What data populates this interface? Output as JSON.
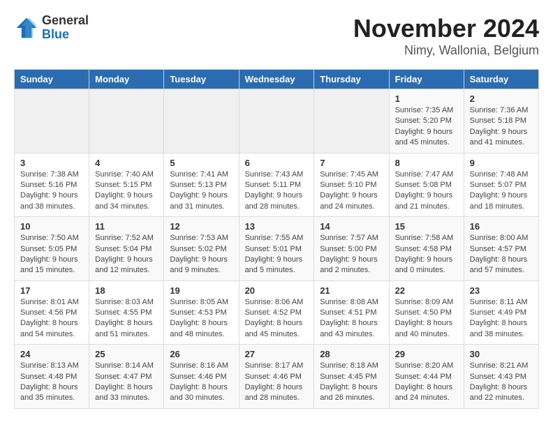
{
  "header": {
    "logo": {
      "general": "General",
      "blue": "Blue"
    },
    "title": "November 2024",
    "subtitle": "Nimy, Wallonia, Belgium"
  },
  "calendar": {
    "days_of_week": [
      "Sunday",
      "Monday",
      "Tuesday",
      "Wednesday",
      "Thursday",
      "Friday",
      "Saturday"
    ],
    "weeks": [
      [
        {
          "day": "",
          "info": ""
        },
        {
          "day": "",
          "info": ""
        },
        {
          "day": "",
          "info": ""
        },
        {
          "day": "",
          "info": ""
        },
        {
          "day": "",
          "info": ""
        },
        {
          "day": "1",
          "info": "Sunrise: 7:35 AM\nSunset: 5:20 PM\nDaylight: 9 hours and 45 minutes."
        },
        {
          "day": "2",
          "info": "Sunrise: 7:36 AM\nSunset: 5:18 PM\nDaylight: 9 hours and 41 minutes."
        }
      ],
      [
        {
          "day": "3",
          "info": "Sunrise: 7:38 AM\nSunset: 5:16 PM\nDaylight: 9 hours and 38 minutes."
        },
        {
          "day": "4",
          "info": "Sunrise: 7:40 AM\nSunset: 5:15 PM\nDaylight: 9 hours and 34 minutes."
        },
        {
          "day": "5",
          "info": "Sunrise: 7:41 AM\nSunset: 5:13 PM\nDaylight: 9 hours and 31 minutes."
        },
        {
          "day": "6",
          "info": "Sunrise: 7:43 AM\nSunset: 5:11 PM\nDaylight: 9 hours and 28 minutes."
        },
        {
          "day": "7",
          "info": "Sunrise: 7:45 AM\nSunset: 5:10 PM\nDaylight: 9 hours and 24 minutes."
        },
        {
          "day": "8",
          "info": "Sunrise: 7:47 AM\nSunset: 5:08 PM\nDaylight: 9 hours and 21 minutes."
        },
        {
          "day": "9",
          "info": "Sunrise: 7:48 AM\nSunset: 5:07 PM\nDaylight: 9 hours and 18 minutes."
        }
      ],
      [
        {
          "day": "10",
          "info": "Sunrise: 7:50 AM\nSunset: 5:05 PM\nDaylight: 9 hours and 15 minutes."
        },
        {
          "day": "11",
          "info": "Sunrise: 7:52 AM\nSunset: 5:04 PM\nDaylight: 9 hours and 12 minutes."
        },
        {
          "day": "12",
          "info": "Sunrise: 7:53 AM\nSunset: 5:02 PM\nDaylight: 9 hours and 9 minutes."
        },
        {
          "day": "13",
          "info": "Sunrise: 7:55 AM\nSunset: 5:01 PM\nDaylight: 9 hours and 5 minutes."
        },
        {
          "day": "14",
          "info": "Sunrise: 7:57 AM\nSunset: 5:00 PM\nDaylight: 9 hours and 2 minutes."
        },
        {
          "day": "15",
          "info": "Sunrise: 7:58 AM\nSunset: 4:58 PM\nDaylight: 9 hours and 0 minutes."
        },
        {
          "day": "16",
          "info": "Sunrise: 8:00 AM\nSunset: 4:57 PM\nDaylight: 8 hours and 57 minutes."
        }
      ],
      [
        {
          "day": "17",
          "info": "Sunrise: 8:01 AM\nSunset: 4:56 PM\nDaylight: 8 hours and 54 minutes."
        },
        {
          "day": "18",
          "info": "Sunrise: 8:03 AM\nSunset: 4:55 PM\nDaylight: 8 hours and 51 minutes."
        },
        {
          "day": "19",
          "info": "Sunrise: 8:05 AM\nSunset: 4:53 PM\nDaylight: 8 hours and 48 minutes."
        },
        {
          "day": "20",
          "info": "Sunrise: 8:06 AM\nSunset: 4:52 PM\nDaylight: 8 hours and 45 minutes."
        },
        {
          "day": "21",
          "info": "Sunrise: 8:08 AM\nSunset: 4:51 PM\nDaylight: 8 hours and 43 minutes."
        },
        {
          "day": "22",
          "info": "Sunrise: 8:09 AM\nSunset: 4:50 PM\nDaylight: 8 hours and 40 minutes."
        },
        {
          "day": "23",
          "info": "Sunrise: 8:11 AM\nSunset: 4:49 PM\nDaylight: 8 hours and 38 minutes."
        }
      ],
      [
        {
          "day": "24",
          "info": "Sunrise: 8:13 AM\nSunset: 4:48 PM\nDaylight: 8 hours and 35 minutes."
        },
        {
          "day": "25",
          "info": "Sunrise: 8:14 AM\nSunset: 4:47 PM\nDaylight: 8 hours and 33 minutes."
        },
        {
          "day": "26",
          "info": "Sunrise: 8:16 AM\nSunset: 4:46 PM\nDaylight: 8 hours and 30 minutes."
        },
        {
          "day": "27",
          "info": "Sunrise: 8:17 AM\nSunset: 4:46 PM\nDaylight: 8 hours and 28 minutes."
        },
        {
          "day": "28",
          "info": "Sunrise: 8:18 AM\nSunset: 4:45 PM\nDaylight: 8 hours and 26 minutes."
        },
        {
          "day": "29",
          "info": "Sunrise: 8:20 AM\nSunset: 4:44 PM\nDaylight: 8 hours and 24 minutes."
        },
        {
          "day": "30",
          "info": "Sunrise: 8:21 AM\nSunset: 4:43 PM\nDaylight: 8 hours and 22 minutes."
        }
      ]
    ]
  }
}
